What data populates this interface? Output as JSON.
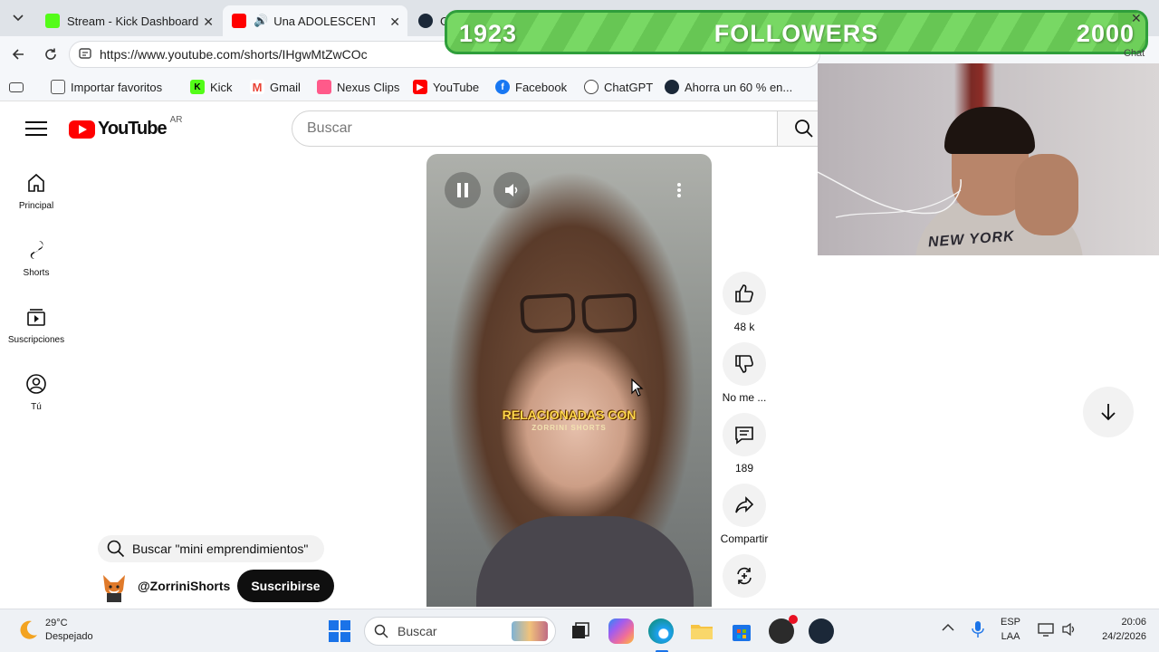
{
  "browser": {
    "tabs": [
      {
        "title": "Stream - Kick Dashboard",
        "favicon_color": "#53fc18",
        "active": false
      },
      {
        "title": "Una ADOLESCENTE y u",
        "favicon_color": "#ff0000",
        "active": true
      },
      {
        "title": "Gr",
        "favicon_color": "#1b2838",
        "active": false
      }
    ],
    "url": "https://www.youtube.com/shorts/IHgwMtZwCOc",
    "bookmarks": [
      {
        "label": "Importar favoritos",
        "icon": "import-icon",
        "color": "#5f6368"
      },
      {
        "label": "Kick",
        "icon": "kick-icon",
        "color": "#53fc18"
      },
      {
        "label": "Gmail",
        "icon": "gmail-icon",
        "color": "#ea4335"
      },
      {
        "label": "Nexus Clips",
        "icon": "nexus-icon",
        "color": "#ff5a8a"
      },
      {
        "label": "YouTube",
        "icon": "youtube-icon",
        "color": "#ff0000"
      },
      {
        "label": "Facebook",
        "icon": "facebook-icon",
        "color": "#1877f2"
      },
      {
        "label": "ChatGPT",
        "icon": "chatgpt-icon",
        "color": "#444444"
      },
      {
        "label": "Ahorra un 60 % en...",
        "icon": "steam-icon",
        "color": "#1b2838"
      }
    ]
  },
  "youtube": {
    "logo": "YouTube",
    "country": "AR",
    "search_placeholder": "Buscar",
    "guide": [
      {
        "label": "Principal",
        "icon": "home-icon"
      },
      {
        "label": "Shorts",
        "icon": "shorts-icon"
      },
      {
        "label": "Suscripciones",
        "icon": "subscriptions-icon"
      },
      {
        "label": "Tú",
        "icon": "you-icon"
      }
    ],
    "short": {
      "caption_line1": "RELACIONADAS CON",
      "caption_line2": "ZORRINI SHORTS"
    },
    "actions": {
      "likes": "48 k",
      "dislike": "No me ...",
      "comments": "189",
      "share": "Compartir"
    },
    "related_search": "Buscar \"mini emprendimientos\"",
    "channel": {
      "handle": "@ZorriniShorts",
      "subscribe": "Suscribirse"
    }
  },
  "overlay": {
    "followers_current": "1923",
    "followers_label": "FOLLOWERS",
    "followers_goal": "2000",
    "progress_fraction": 0.9615,
    "chat_label": "Chat",
    "webcam_shirt_text": "NEW YORK"
  },
  "taskbar": {
    "temperature": "29°C",
    "weather": "Despejado",
    "search": "Buscar",
    "lang_top": "ESP",
    "lang_bottom": "LAA",
    "time": "20:06",
    "date": "24/2/2026"
  }
}
